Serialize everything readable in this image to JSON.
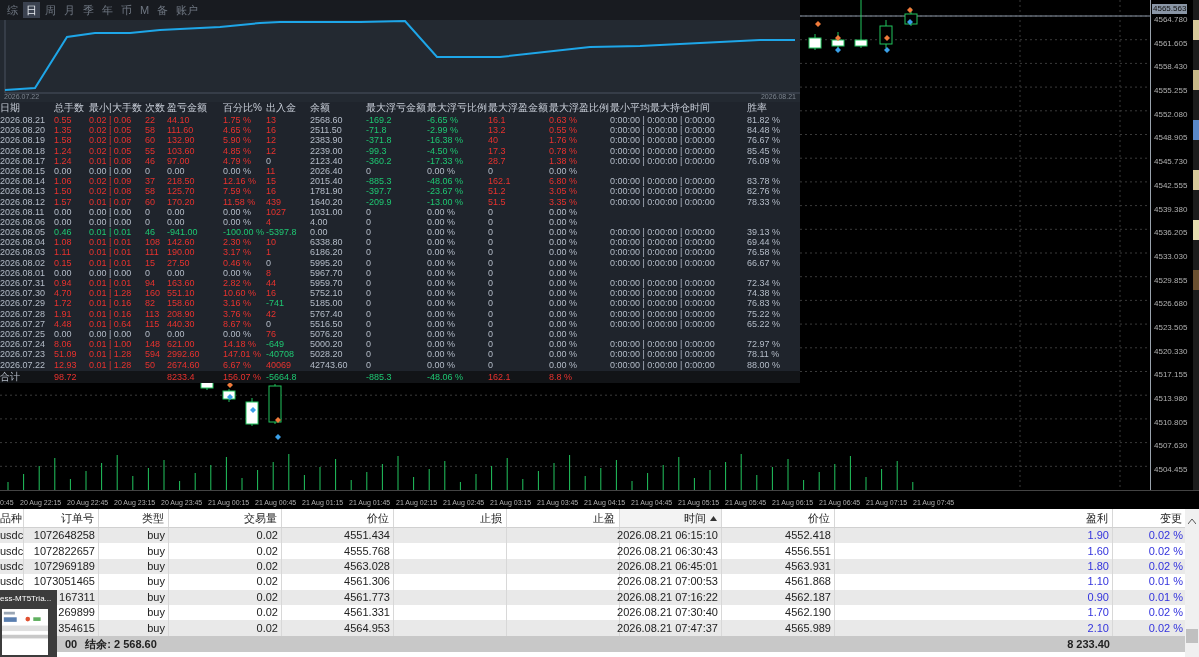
{
  "overview_panel": {
    "tabs": [
      {
        "label": "综",
        "selected": false
      },
      {
        "label": "日",
        "selected": true
      },
      {
        "label": "周",
        "selected": false
      },
      {
        "label": "月",
        "selected": false
      },
      {
        "label": "季",
        "selected": false
      },
      {
        "label": "年",
        "selected": false
      },
      {
        "label": "币",
        "selected": false
      },
      {
        "label": "M",
        "selected": false
      },
      {
        "label": "备",
        "selected": false
      },
      {
        "label": "账户",
        "selected": false
      }
    ],
    "equity_chart": {
      "start_date": "2026.07.22",
      "end_date": "2026.08.21"
    },
    "table": {
      "columns": [
        "日期",
        "总手数",
        "最小|大手数",
        "次数",
        "盈亏金额",
        "百分比%",
        "出入金",
        "余额",
        "最大浮亏金额",
        "最大浮亏比例",
        "最大浮盈金额",
        "最大浮盈比例",
        "最小平均最大持仓时间",
        "胜率"
      ],
      "rows": [
        {
          "gain": true,
          "loss": false,
          "inflow": true,
          "outflow": false,
          "floating": true,
          "cells": [
            "2026.08.21",
            "0.55",
            "0.02 | 0.06",
            "22",
            "44.10",
            "1.75 %",
            "13",
            "2568.60",
            "-169.2",
            "-6.65 %",
            "16.1",
            "0.63 %",
            "0:00:00 | 0:00:00 | 0:00:00",
            "81.82 %"
          ]
        },
        {
          "gain": true,
          "loss": false,
          "inflow": true,
          "outflow": false,
          "floating": true,
          "cells": [
            "2026.08.20",
            "1.35",
            "0.02 | 0.05",
            "58",
            "111.60",
            "4.65 %",
            "16",
            "2511.50",
            "-71.8",
            "-2.99 %",
            "13.2",
            "0.55 %",
            "0:00:00 | 0:00:00 | 0:00:00",
            "84.48 %"
          ]
        },
        {
          "gain": true,
          "loss": false,
          "inflow": true,
          "outflow": false,
          "floating": true,
          "cells": [
            "2026.08.19",
            "1.58",
            "0.02 | 0.08",
            "60",
            "132.90",
            "5.90 %",
            "12",
            "2383.90",
            "-371.8",
            "-16.38 %",
            "40",
            "1.76 %",
            "0:00:00 | 0:00:00 | 0:00:00",
            "76.67 %"
          ]
        },
        {
          "gain": true,
          "loss": false,
          "inflow": true,
          "outflow": false,
          "floating": true,
          "cells": [
            "2026.08.18",
            "1.24",
            "0.02 | 0.05",
            "55",
            "103.60",
            "4.85 %",
            "12",
            "2239.00",
            "-99.3",
            "-4.50 %",
            "17.3",
            "0.78 %",
            "0:00:00 | 0:00:00 | 0:00:00",
            "85.45 %"
          ]
        },
        {
          "gain": true,
          "loss": false,
          "inflow": false,
          "outflow": false,
          "floating": true,
          "cells": [
            "2026.08.17",
            "1.24",
            "0.01 | 0.08",
            "46",
            "97.00",
            "4.79 %",
            "0",
            "2123.40",
            "-360.2",
            "-17.33 %",
            "28.7",
            "1.38 %",
            "0:00:00 | 0:00:00 | 0:00:00",
            "76.09 %"
          ]
        },
        {
          "gain": false,
          "loss": false,
          "inflow": true,
          "outflow": false,
          "floating": false,
          "cells": [
            "2026.08.15",
            "0.00",
            "0.00 | 0.00",
            "0",
            "0.00",
            "0.00 %",
            "11",
            "2026.40",
            "0",
            "0.00 %",
            "0",
            "0.00 %"
          ]
        },
        {
          "gain": true,
          "loss": false,
          "inflow": true,
          "outflow": false,
          "floating": true,
          "cells": [
            "2026.08.14",
            "1.06",
            "0.02 | 0.09",
            "37",
            "218.50",
            "12.16 %",
            "15",
            "2015.40",
            "-885.3",
            "-48.06 %",
            "162.1",
            "6.80 %",
            "0:00:00 | 0:00:00 | 0:00:00",
            "83.78 %"
          ]
        },
        {
          "gain": true,
          "loss": false,
          "inflow": true,
          "outflow": false,
          "floating": true,
          "cells": [
            "2026.08.13",
            "1.50",
            "0.02 | 0.08",
            "58",
            "125.70",
            "7.59 %",
            "16",
            "1781.90",
            "-397.7",
            "-23.67 %",
            "51.2",
            "3.05 %",
            "0:00:00 | 0:00:00 | 0:00:00",
            "82.76 %"
          ]
        },
        {
          "gain": true,
          "loss": false,
          "inflow": true,
          "outflow": false,
          "floating": true,
          "cells": [
            "2026.08.12",
            "1.57",
            "0.01 | 0.07",
            "60",
            "170.20",
            "11.58 %",
            "439",
            "1640.20",
            "-209.9",
            "-13.00 %",
            "51.5",
            "3.35 %",
            "0:00:00 | 0:00:00 | 0:00:00",
            "78.33 %"
          ]
        },
        {
          "gain": false,
          "loss": false,
          "inflow": true,
          "outflow": false,
          "floating": false,
          "cells": [
            "2026.08.11",
            "0.00",
            "0.00 | 0.00",
            "0",
            "0.00",
            "0.00 %",
            "1027",
            "1031.00",
            "0",
            "0.00 %",
            "0",
            "0.00 %"
          ]
        },
        {
          "gain": false,
          "loss": false,
          "inflow": true,
          "outflow": false,
          "floating": false,
          "cells": [
            "2026.08.06",
            "0.00",
            "0.00 | 0.00",
            "0",
            "0.00",
            "0.00 %",
            "4",
            "4.00",
            "0",
            "0.00 %",
            "0",
            "0.00 %"
          ]
        },
        {
          "gain": false,
          "loss": true,
          "inflow": false,
          "outflow": true,
          "floating": false,
          "cells": [
            "2026.08.05",
            "0.46",
            "0.01 | 0.01",
            "46",
            "-941.00",
            "-100.00 %",
            "-5397.8",
            "0.00",
            "0",
            "0.00 %",
            "0",
            "0.00 %",
            "0:00:00 | 0:00:00 | 0:00:00",
            "39.13 %"
          ]
        },
        {
          "gain": true,
          "loss": false,
          "inflow": true,
          "outflow": false,
          "floating": false,
          "cells": [
            "2026.08.04",
            "1.08",
            "0.01 | 0.01",
            "108",
            "142.60",
            "2.30 %",
            "10",
            "6338.80",
            "0",
            "0.00 %",
            "0",
            "0.00 %",
            "0:00:00 | 0:00:00 | 0:00:00",
            "69.44 %"
          ]
        },
        {
          "gain": true,
          "loss": false,
          "inflow": true,
          "outflow": false,
          "floating": false,
          "cells": [
            "2026.08.03",
            "1.11",
            "0.01 | 0.01",
            "111",
            "190.00",
            "3.17 %",
            "1",
            "6186.20",
            "0",
            "0.00 %",
            "0",
            "0.00 %",
            "0:00:00 | 0:00:00 | 0:00:00",
            "76.58 %"
          ]
        },
        {
          "gain": true,
          "loss": false,
          "inflow": false,
          "outflow": false,
          "floating": false,
          "cells": [
            "2026.08.02",
            "0.15",
            "0.01 | 0.01",
            "15",
            "27.50",
            "0.46 %",
            "0",
            "5995.20",
            "0",
            "0.00 %",
            "0",
            "0.00 %",
            "0:00:00 | 0:00:00 | 0:00:00",
            "66.67 %"
          ]
        },
        {
          "gain": false,
          "loss": false,
          "inflow": true,
          "outflow": false,
          "floating": false,
          "cells": [
            "2026.08.01",
            "0.00",
            "0.00 | 0.00",
            "0",
            "0.00",
            "0.00 %",
            "8",
            "5967.70",
            "0",
            "0.00 %",
            "0",
            "0.00 %"
          ]
        },
        {
          "gain": true,
          "loss": false,
          "inflow": true,
          "outflow": false,
          "floating": false,
          "cells": [
            "2026.07.31",
            "0.94",
            "0.01 | 0.01",
            "94",
            "163.60",
            "2.82 %",
            "44",
            "5959.70",
            "0",
            "0.00 %",
            "0",
            "0.00 %",
            "0:00:00 | 0:00:00 | 0:00:00",
            "72.34 %"
          ]
        },
        {
          "gain": true,
          "loss": false,
          "inflow": true,
          "outflow": false,
          "floating": false,
          "cells": [
            "2026.07.30",
            "4.70",
            "0.01 | 1.28",
            "160",
            "551.10",
            "10.60 %",
            "16",
            "5752.10",
            "0",
            "0.00 %",
            "0",
            "0.00 %",
            "0:00:00 | 0:00:00 | 0:00:00",
            "74.38 %"
          ]
        },
        {
          "gain": true,
          "loss": false,
          "inflow": false,
          "outflow": true,
          "floating": false,
          "cells": [
            "2026.07.29",
            "1.72",
            "0.01 | 0.16",
            "82",
            "158.60",
            "3.16 %",
            "-741",
            "5185.00",
            "0",
            "0.00 %",
            "0",
            "0.00 %",
            "0:00:00 | 0:00:00 | 0:00:00",
            "76.83 %"
          ]
        },
        {
          "gain": true,
          "loss": false,
          "inflow": true,
          "outflow": false,
          "floating": false,
          "cells": [
            "2026.07.28",
            "1.91",
            "0.01 | 0.16",
            "113",
            "208.90",
            "3.76 %",
            "42",
            "5767.40",
            "0",
            "0.00 %",
            "0",
            "0.00 %",
            "0:00:00 | 0:00:00 | 0:00:00",
            "75.22 %"
          ]
        },
        {
          "gain": true,
          "loss": false,
          "inflow": false,
          "outflow": false,
          "floating": false,
          "cells": [
            "2026.07.27",
            "4.48",
            "0.01 | 0.64",
            "115",
            "440.30",
            "8.67 %",
            "0",
            "5516.50",
            "0",
            "0.00 %",
            "0",
            "0.00 %",
            "0:00:00 | 0:00:00 | 0:00:00",
            "65.22 %"
          ]
        },
        {
          "gain": false,
          "loss": false,
          "inflow": true,
          "outflow": false,
          "floating": false,
          "cells": [
            "2026.07.25",
            "0.00",
            "0.00 | 0.00",
            "0",
            "0.00",
            "0.00 %",
            "76",
            "5076.20",
            "0",
            "0.00 %",
            "0",
            "0.00 %"
          ]
        },
        {
          "gain": true,
          "loss": false,
          "inflow": false,
          "outflow": true,
          "floating": false,
          "cells": [
            "2026.07.24",
            "8.06",
            "0.01 | 1.00",
            "148",
            "621.00",
            "14.18 %",
            "-649",
            "5000.20",
            "0",
            "0.00 %",
            "0",
            "0.00 %",
            "0:00:00 | 0:00:00 | 0:00:00",
            "72.97 %"
          ]
        },
        {
          "gain": true,
          "loss": false,
          "inflow": false,
          "outflow": true,
          "floating": false,
          "cells": [
            "2026.07.23",
            "51.09",
            "0.01 | 1.28",
            "594",
            "2992.60",
            "147.01 %",
            "-40708",
            "5028.20",
            "0",
            "0.00 %",
            "0",
            "0.00 %",
            "0:00:00 | 0:00:00 | 0:00:00",
            "78.11 %"
          ]
        },
        {
          "gain": true,
          "loss": false,
          "inflow": true,
          "outflow": false,
          "floating": false,
          "cells": [
            "2026.07.22",
            "12.93",
            "0.01 | 1.28",
            "50",
            "2674.60",
            "6.67 %",
            "40069",
            "42743.60",
            "0",
            "0.00 %",
            "0",
            "0.00 %",
            "0:00:00 | 0:00:00 | 0:00:00",
            "88.00 %"
          ]
        }
      ],
      "total": {
        "label": "合计",
        "lots": "98.72",
        "profit": "8233.4",
        "percent": "156.07 %",
        "flow": "-5664.8",
        "max_loss": "-885.3",
        "max_loss_pct": "-48.06 %",
        "max_gain": "162.1",
        "max_gain_pct": "8.8 %"
      }
    }
  },
  "price_chart": {
    "current_price": "4565.563",
    "price_labels": [
      "4564.780",
      "4561.605",
      "4558.430",
      "4555.255",
      "4552.080",
      "4548.905",
      "4545.730",
      "4542.555",
      "4539.380",
      "4536.205",
      "4533.030",
      "4529.855",
      "4526.680",
      "4523.505",
      "4520.330",
      "4517.155",
      "4513.980",
      "4510.805",
      "4507.630",
      "4504.455"
    ],
    "time_labels": [
      "0:45",
      "20 Aug 22:15",
      "20 Aug 22:45",
      "20 Aug 23:15",
      "20 Aug 23:45",
      "21 Aug 00:15",
      "21 Aug 00:45",
      "21 Aug 01:15",
      "21 Aug 01:45",
      "21 Aug 02:15",
      "21 Aug 02:45",
      "21 Aug 03:15",
      "21 Aug 03:45",
      "21 Aug 04:15",
      "21 Aug 04:45",
      "21 Aug 05:15",
      "21 Aug 05:45",
      "21 Aug 06:15",
      "21 Aug 06:45",
      "21 Aug 07:15",
      "21 Aug 07:45"
    ]
  },
  "positions_table": {
    "columns": [
      {
        "label": "品种",
        "sorted": false
      },
      {
        "label": "订单号",
        "sorted": false
      },
      {
        "label": "类型",
        "sorted": false
      },
      {
        "label": "交易量",
        "sorted": false
      },
      {
        "label": "价位",
        "sorted": false
      },
      {
        "label": "止损",
        "sorted": false
      },
      {
        "label": "止盈",
        "sorted": false
      },
      {
        "label": "时间",
        "sorted": true
      },
      {
        "label": "价位",
        "sorted": false
      },
      {
        "label": "盈利",
        "sorted": false
      },
      {
        "label": "变更",
        "sorted": false
      }
    ],
    "rows": [
      {
        "symbol": "usdc",
        "order": "1072648258",
        "type": "buy",
        "volume": "0.02",
        "open_price": "4551.434",
        "time": "2026.08.21 06:15:10",
        "price": "4552.418",
        "profit": "1.90",
        "change": "0.02 %"
      },
      {
        "symbol": "usdc",
        "order": "1072822657",
        "type": "buy",
        "volume": "0.02",
        "open_price": "4555.768",
        "time": "2026.08.21 06:30:43",
        "price": "4556.551",
        "profit": "1.60",
        "change": "0.02 %"
      },
      {
        "symbol": "usdc",
        "order": "1072969189",
        "type": "buy",
        "volume": "0.02",
        "open_price": "4563.028",
        "time": "2026.08.21 06:45:01",
        "price": "4563.931",
        "profit": "1.80",
        "change": "0.02 %"
      },
      {
        "symbol": "usdc",
        "order": "1073051465",
        "type": "buy",
        "volume": "0.02",
        "open_price": "4561.306",
        "time": "2026.08.21 07:00:53",
        "price": "4561.868",
        "profit": "1.10",
        "change": "0.01 %"
      },
      {
        "order": "167311",
        "type": "buy",
        "volume": "0.02",
        "open_price": "4561.773",
        "time": "2026.08.21 07:16:22",
        "price": "4562.187",
        "profit": "0.90",
        "change": "0.01 %"
      },
      {
        "order": "269899",
        "type": "buy",
        "volume": "0.02",
        "open_price": "4561.331",
        "time": "2026.08.21 07:30:40",
        "price": "4562.190",
        "profit": "1.70",
        "change": "0.02 %"
      },
      {
        "order": "354615",
        "type": "buy",
        "volume": "0.02",
        "open_price": "4564.953",
        "time": "2026.08.21 07:47:37",
        "price": "4565.989",
        "profit": "2.10",
        "change": "0.02 %"
      }
    ],
    "total": {
      "count_tail": "00",
      "balance": "结余: 2 568.60",
      "profit": "8 233.40"
    }
  },
  "taskbar_preview": {
    "title": "ess-MT5Tria..."
  }
}
